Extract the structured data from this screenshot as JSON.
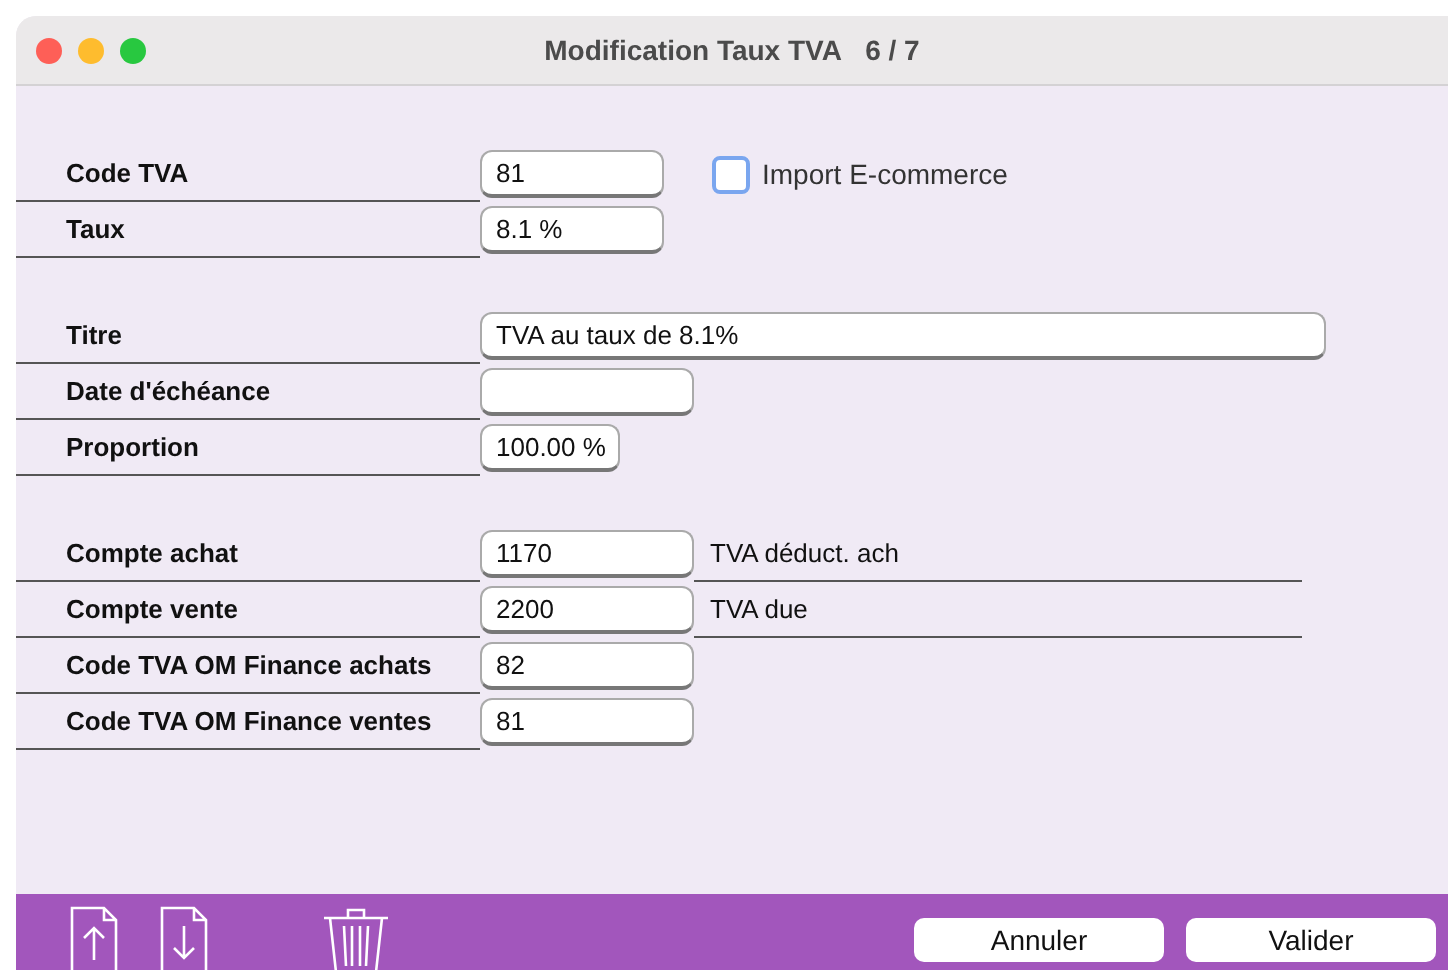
{
  "window": {
    "title": "Modification Taux TVA",
    "counter": "6 / 7"
  },
  "checkbox": {
    "label": "Import E-commerce",
    "checked": false
  },
  "groups": [
    {
      "rows": [
        {
          "kind": "code",
          "label": "Code TVA",
          "value": "81"
        },
        {
          "kind": "code",
          "label": "Taux",
          "value": "8.1 %"
        }
      ]
    },
    {
      "rows": [
        {
          "kind": "text",
          "label": "Titre",
          "value": "TVA au taux de 8.1%"
        },
        {
          "kind": "date",
          "label": "Date d'échéance",
          "value": ""
        },
        {
          "kind": "percent",
          "label": "Proportion",
          "value": "100.00 %"
        }
      ]
    },
    {
      "rows": [
        {
          "kind": "account",
          "label": "Compte achat",
          "value": "1170",
          "note": "TVA déduct. ach"
        },
        {
          "kind": "account",
          "label": "Compte vente",
          "value": "2200",
          "note": "TVA due"
        },
        {
          "kind": "account",
          "label": "Code TVA OM Finance achats",
          "value": "82"
        },
        {
          "kind": "account",
          "label": "Code TVA OM Finance ventes",
          "value": "81"
        }
      ]
    }
  ],
  "buttons": [
    "Annuler",
    "Valider"
  ]
}
